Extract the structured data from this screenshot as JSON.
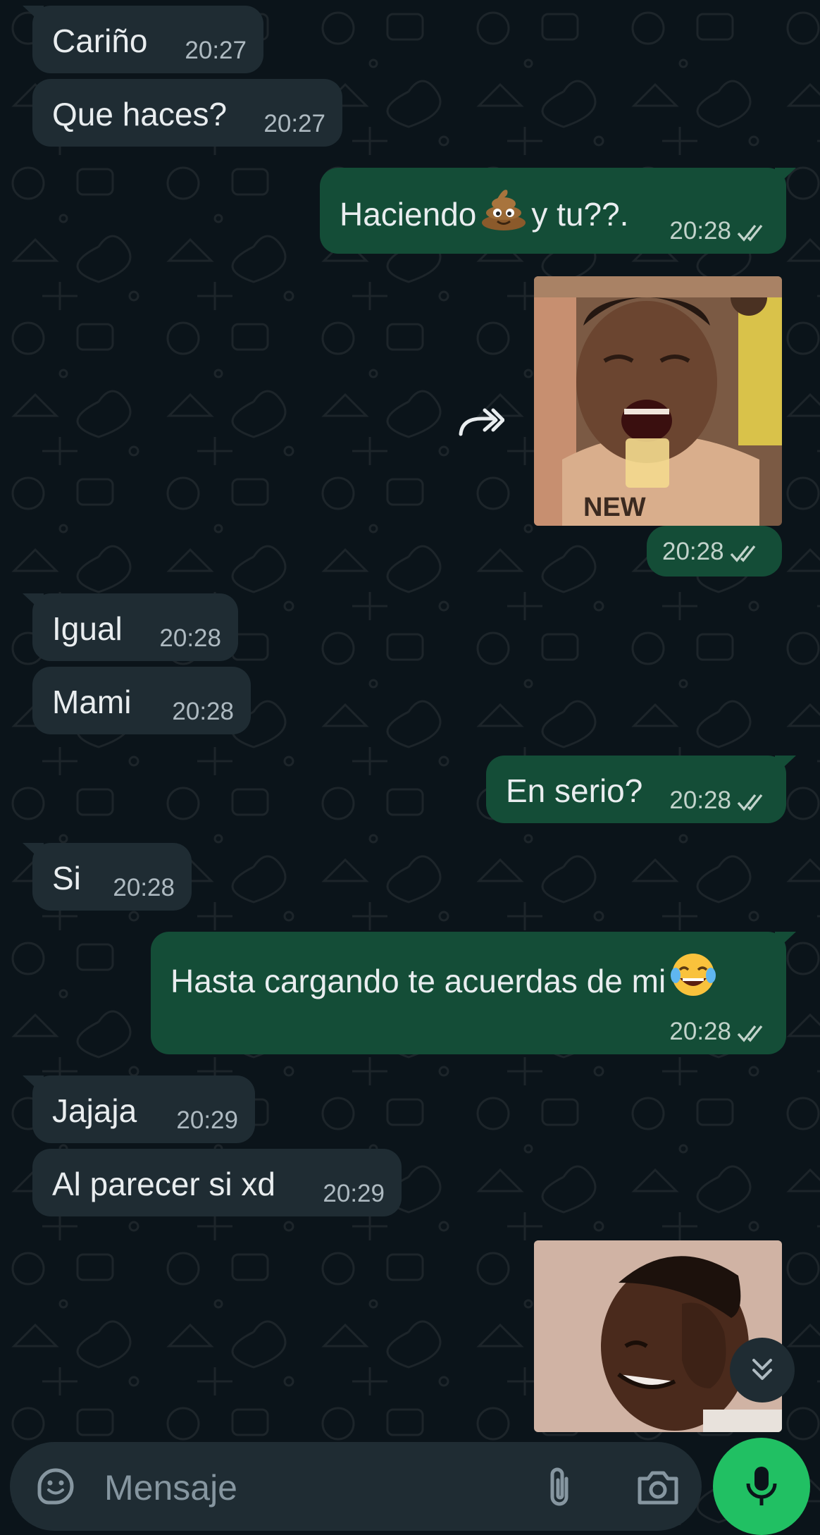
{
  "colors": {
    "background": "#0b141a",
    "incoming_bubble": "#1f2c33",
    "outgoing_bubble": "#144d37",
    "accent_green": "#21c063",
    "read_ticks": "#c2d3cb"
  },
  "messages": [
    {
      "direction": "in",
      "text": "Cariño",
      "time": "20:27"
    },
    {
      "direction": "in",
      "text": "Que haces?",
      "time": "20:27"
    },
    {
      "direction": "out",
      "text_before": "Haciendo",
      "emoji": "pile-of-poo",
      "text_after": "y tu??.",
      "time": "20:28",
      "status": "read"
    },
    {
      "direction": "out",
      "type": "image",
      "description_icon": "laughing-man-photo",
      "time": "20:28",
      "status": "read",
      "forward_icon": "forward-icon"
    },
    {
      "direction": "in",
      "text": "Igual",
      "time": "20:28"
    },
    {
      "direction": "in",
      "text": "Mami",
      "time": "20:28"
    },
    {
      "direction": "out",
      "text": "En serio?",
      "time": "20:28",
      "status": "read"
    },
    {
      "direction": "in",
      "text": "Si",
      "time": "20:28"
    },
    {
      "direction": "out",
      "text": "Hasta cargando te acuerdas de mi",
      "emoji": "face-with-tears-of-joy",
      "time": "20:28",
      "status": "read"
    },
    {
      "direction": "in",
      "text": "Jajaja",
      "time": "20:29"
    },
    {
      "direction": "in",
      "text": "Al parecer si xd",
      "time": "20:29"
    },
    {
      "direction": "out",
      "type": "image",
      "description_icon": "laughing-boy-photo"
    }
  ],
  "composer": {
    "placeholder": "Mensaje",
    "sticker_icon": "sticker-icon",
    "attach_icon": "paperclip-icon",
    "camera_icon": "camera-icon",
    "mic_icon": "microphone-icon"
  },
  "scroll_down_icon": "double-chevron-down-icon"
}
